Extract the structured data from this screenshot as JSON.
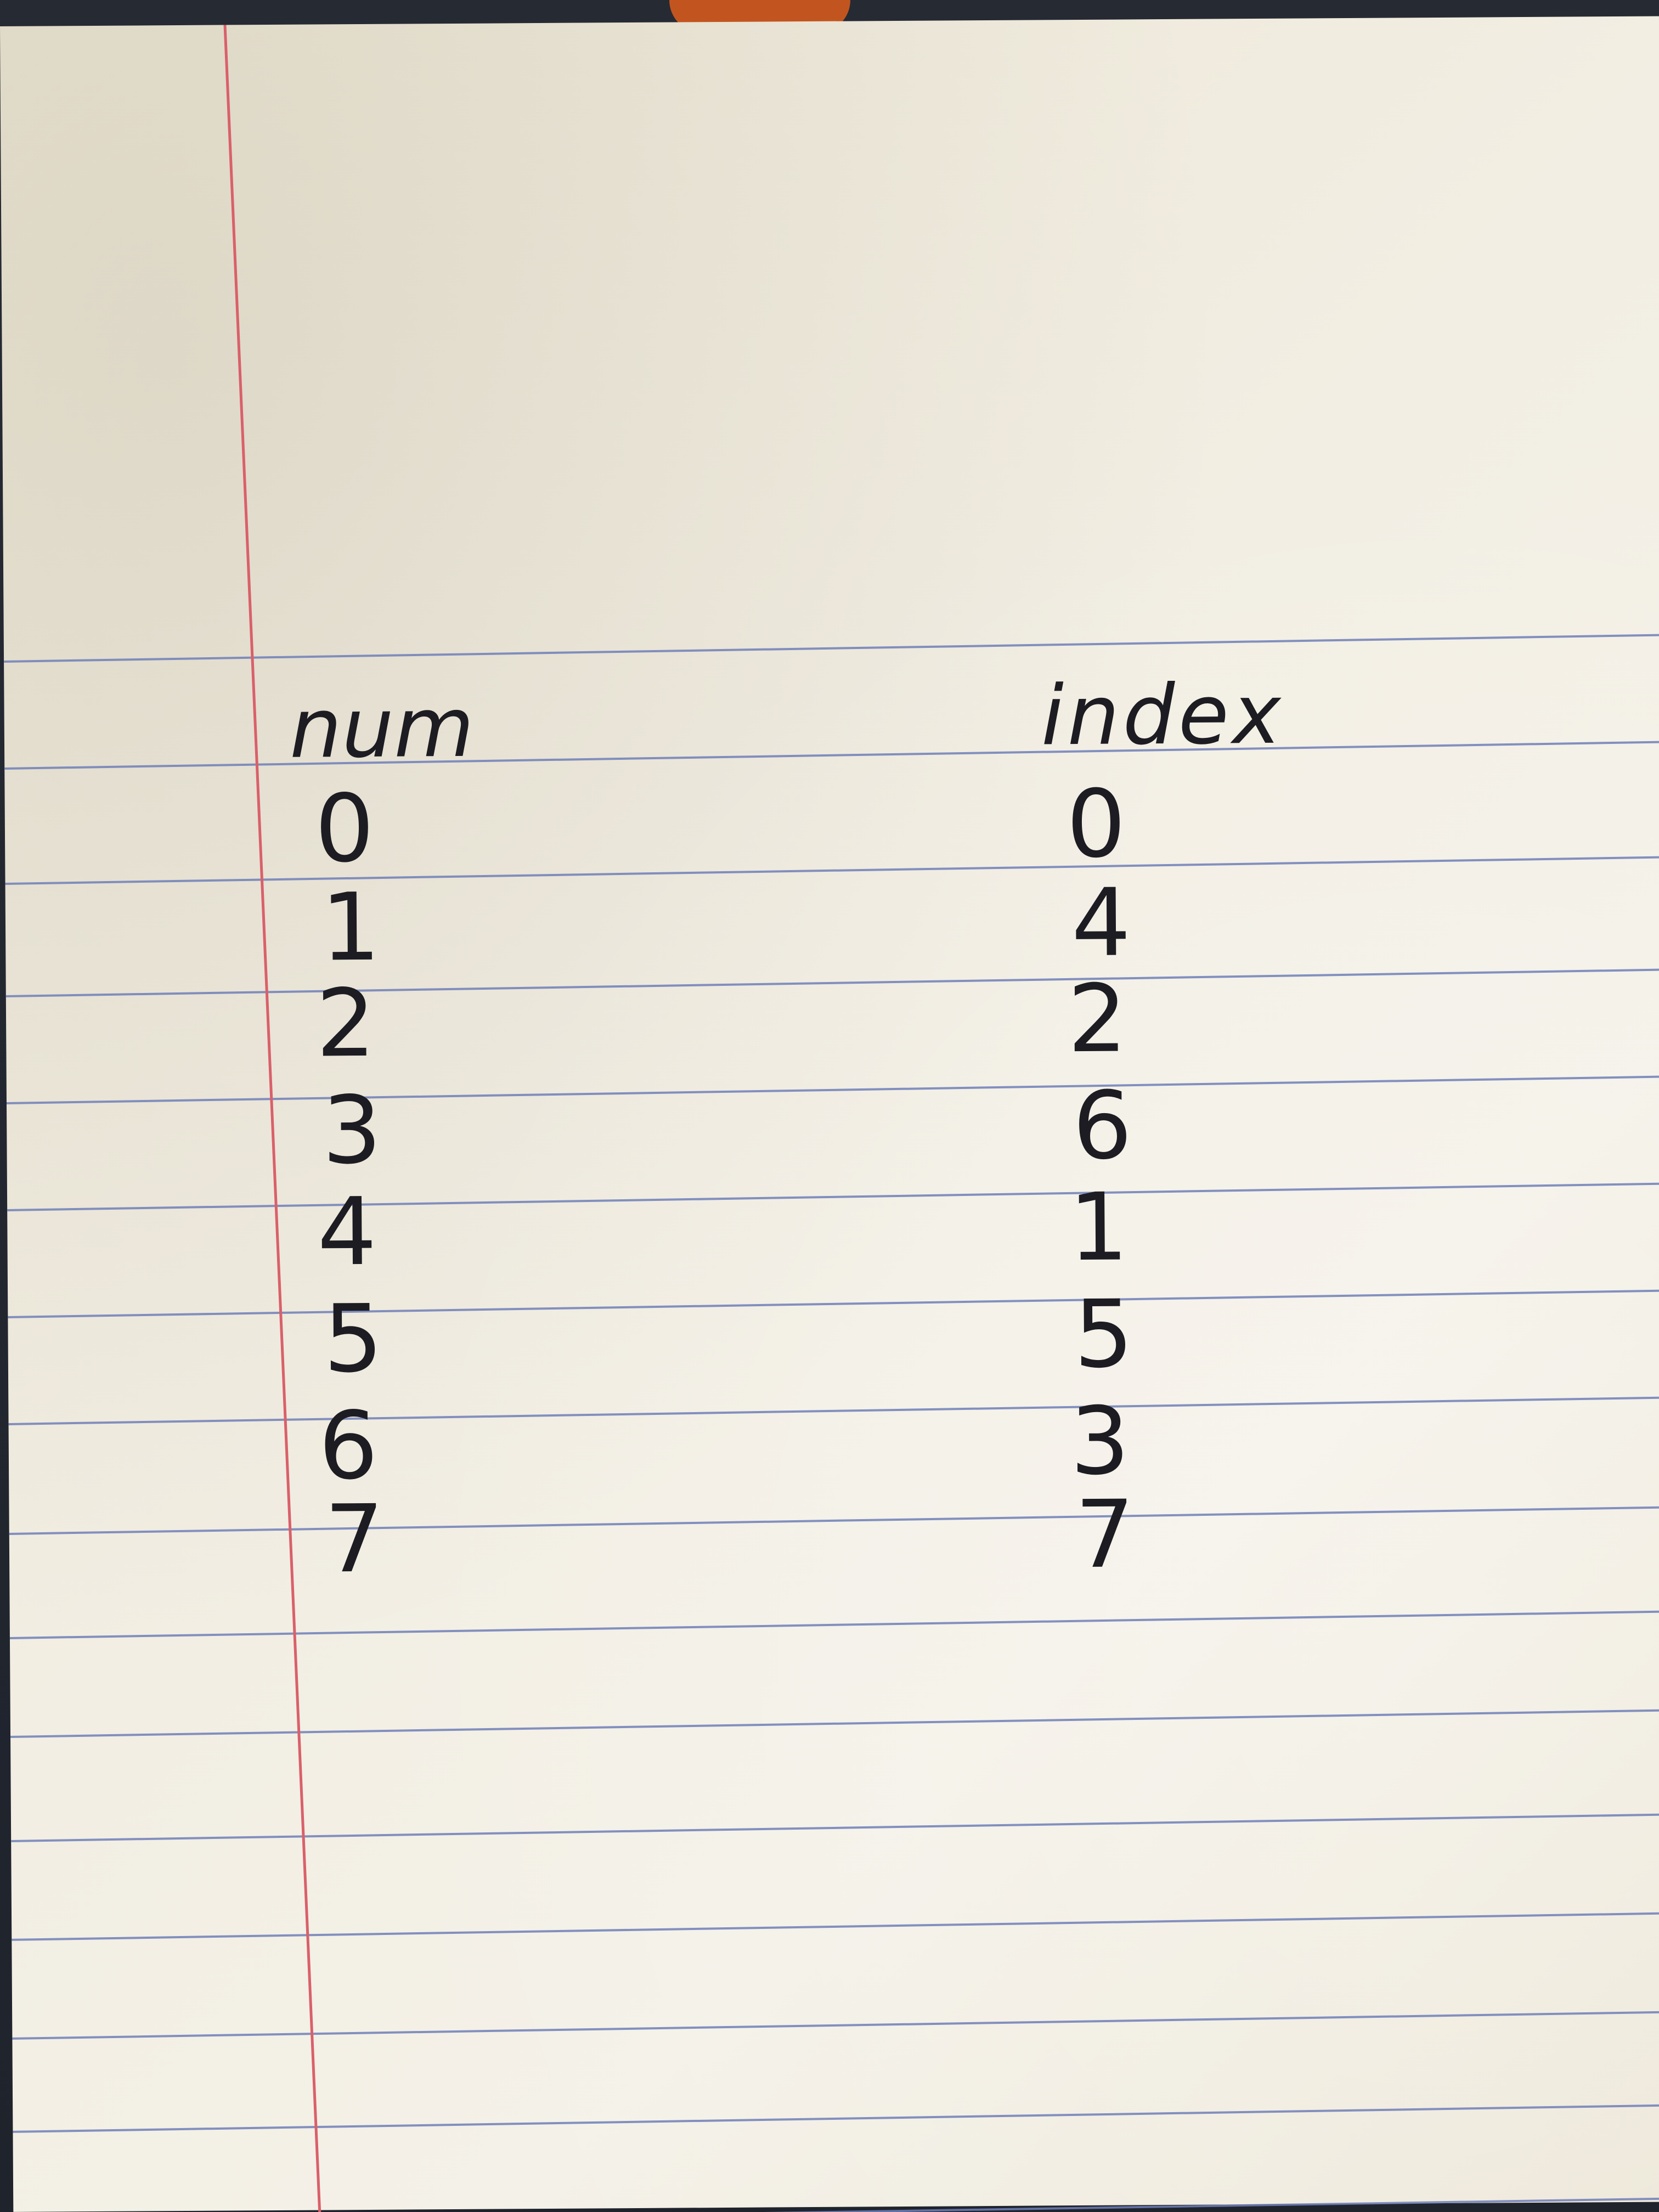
{
  "note": {
    "headers": {
      "num": "num",
      "index": "index"
    },
    "rows": [
      {
        "num": "0",
        "index": "0"
      },
      {
        "num": "1",
        "index": "4"
      },
      {
        "num": "2",
        "index": "2"
      },
      {
        "num": "3",
        "index": "6"
      },
      {
        "num": "4",
        "index": "1"
      },
      {
        "num": "5",
        "index": "5"
      },
      {
        "num": "6",
        "index": "3"
      },
      {
        "num": "7",
        "index": "7"
      }
    ]
  },
  "colors": {
    "paper": "#f2eee3",
    "rule_line": "#6f7fb8",
    "margin_line": "#d9606a",
    "ink": "#1c1c22"
  }
}
